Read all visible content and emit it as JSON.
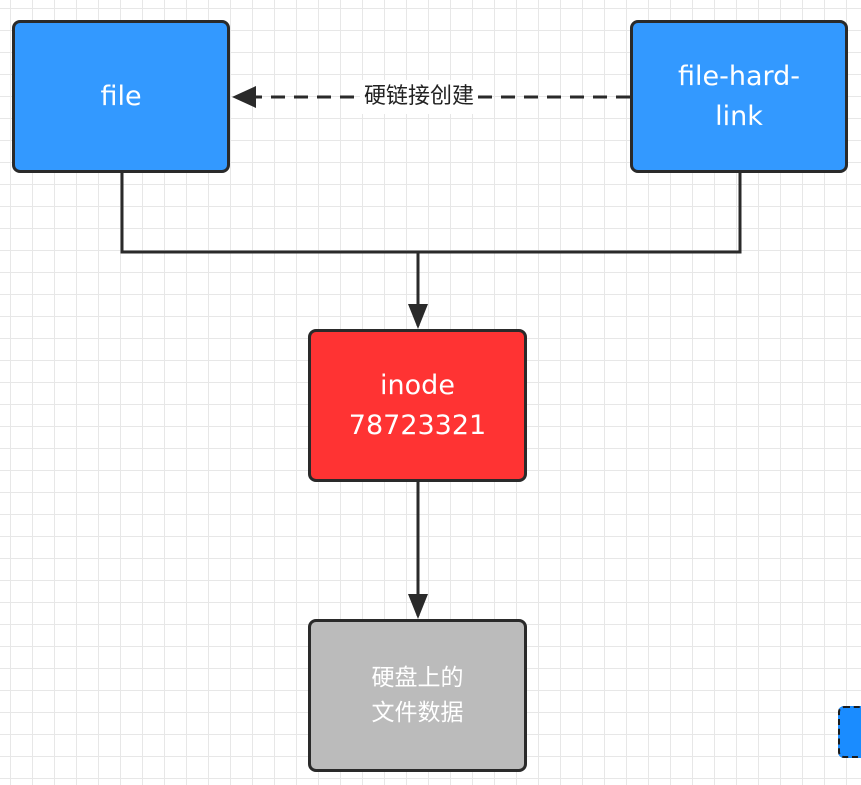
{
  "nodes": {
    "file": {
      "label": "file",
      "color": "#3399ff"
    },
    "hard_link": {
      "lines": [
        "file-hard-",
        "link"
      ],
      "color": "#3399ff"
    },
    "inode": {
      "lines": [
        "inode",
        "78723321"
      ],
      "color": "#ff3333"
    },
    "disk_data": {
      "lines": [
        "硬盘上的",
        "文件数据"
      ],
      "color": "#bbbbbb"
    }
  },
  "edges": {
    "hard_link_to_file": {
      "label": "硬链接创建"
    }
  },
  "colors": {
    "stroke": "#2a2a2a",
    "grid": "#e7e7e7",
    "partial_node": "#1a8cff"
  }
}
